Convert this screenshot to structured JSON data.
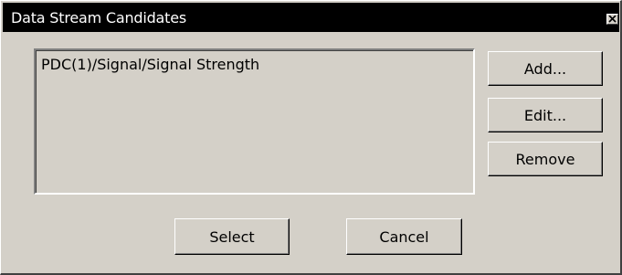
{
  "window": {
    "title": "Data Stream Candidates",
    "close_icon": "close-icon"
  },
  "candidates_list": {
    "items": [
      {
        "label": "PDC(1)/Signal/Signal Strength"
      }
    ]
  },
  "side_buttons": {
    "add_label": "Add...",
    "edit_label": "Edit...",
    "remove_label": "Remove"
  },
  "footer_buttons": {
    "select_label": "Select",
    "cancel_label": "Cancel"
  },
  "colors": {
    "face": "#d4d0c8",
    "titlebar": "#000000",
    "title_text": "#ffffff"
  }
}
